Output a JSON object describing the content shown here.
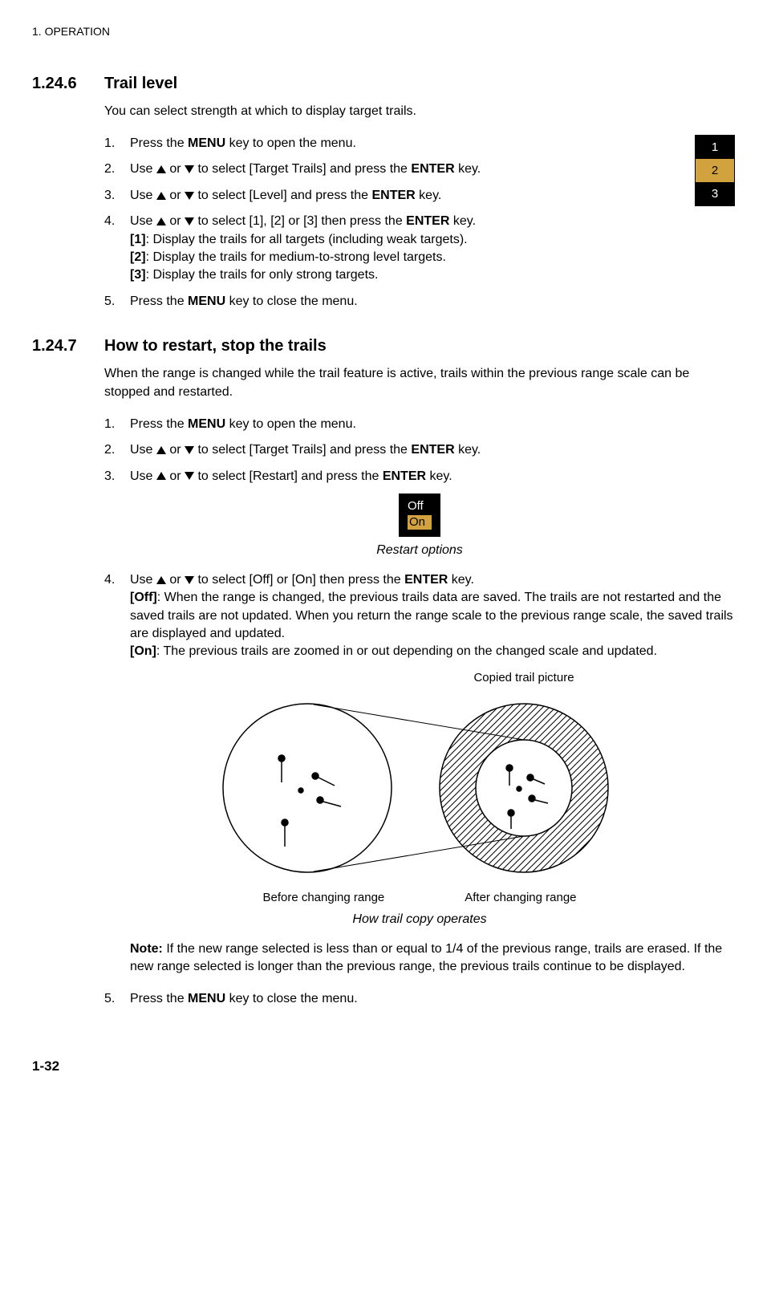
{
  "header": "1.  OPERATION",
  "section1": {
    "num": "1.24.6",
    "title": "Trail level",
    "intro": "You can select strength at which to display target trails.",
    "steps": [
      {
        "n": "1.",
        "pre": "Press the ",
        "bold1": "MENU",
        "post": " key to open the menu."
      },
      {
        "n": "2.",
        "pre": "Use ",
        "mid": " to select [Target Trails] and press the ",
        "bold1": "ENTER",
        "post": " key.",
        "arrows": true
      },
      {
        "n": "3.",
        "pre": "Use ",
        "mid": " to select [Level] and press the ",
        "bold1": "ENTER",
        "post": " key.",
        "arrows": true
      },
      {
        "n": "4.",
        "pre": "Use ",
        "mid": " to select [1], [2] or [3] then press the ",
        "bold1": "ENTER",
        "post": " key.",
        "arrows": true,
        "lines": [
          {
            "b": "[1]",
            "t": ": Display the trails for all targets (including weak targets)."
          },
          {
            "b": "[2]",
            "t": ": Display the trails for medium-to-strong level targets."
          },
          {
            "b": "[3]",
            "t": ": Display the trails for only strong targets."
          }
        ]
      },
      {
        "n": "5.",
        "pre": "Press the ",
        "bold1": "MENU",
        "post": " key to close the menu."
      }
    ],
    "sidebox": [
      "1",
      "2",
      "3"
    ]
  },
  "section2": {
    "num": "1.24.7",
    "title": "How to restart, stop the trails",
    "intro": "When the range is changed while the trail feature is active, trails within the previous range scale can be stopped and restarted.",
    "steps_a": [
      {
        "n": "1.",
        "pre": "Press the ",
        "bold1": "MENU",
        "post": " key to open the menu."
      },
      {
        "n": "2.",
        "pre": "Use ",
        "mid": " to select [Target Trails] and press the ",
        "bold1": "ENTER",
        "post": " key.",
        "arrows": true
      },
      {
        "n": "3.",
        "pre": "Use ",
        "mid": " to select [Restart] and press the ",
        "bold1": "ENTER",
        "post": " key.",
        "arrows": true
      }
    ],
    "restart_box": {
      "off": "Off",
      "on": "On"
    },
    "restart_caption": "Restart options",
    "step4": {
      "n": "4.",
      "pre": "Use ",
      "mid": " to select [Off] or [On] then press the ",
      "bold1": "ENTER",
      "post": " key.",
      "arrows": true,
      "off_b": "[Off]",
      "off_t": ": When the range is changed, the previous trails data are saved. The trails are not restarted and the saved trails are not updated. When you return the range scale to the previous range scale, the saved trails are displayed and updated.",
      "on_b": "[On]",
      "on_t": ": The previous trails are zoomed in or out depending on the changed scale and updated."
    },
    "diag_top": "Copied trail picture",
    "diag_left": "Before changing range",
    "diag_right": "After changing range",
    "diag_caption": "How trail copy operates",
    "note_b": "Note:",
    "note_t": " If the new range selected is less than or equal to 1/4 of the previous range, trails are erased. If the new range selected is longer than the previous range, the previous trails continue to be displayed.",
    "step5": {
      "n": "5.",
      "pre": "Press the ",
      "bold1": "MENU",
      "post": " key to close the menu."
    }
  },
  "page_num": "1-32"
}
